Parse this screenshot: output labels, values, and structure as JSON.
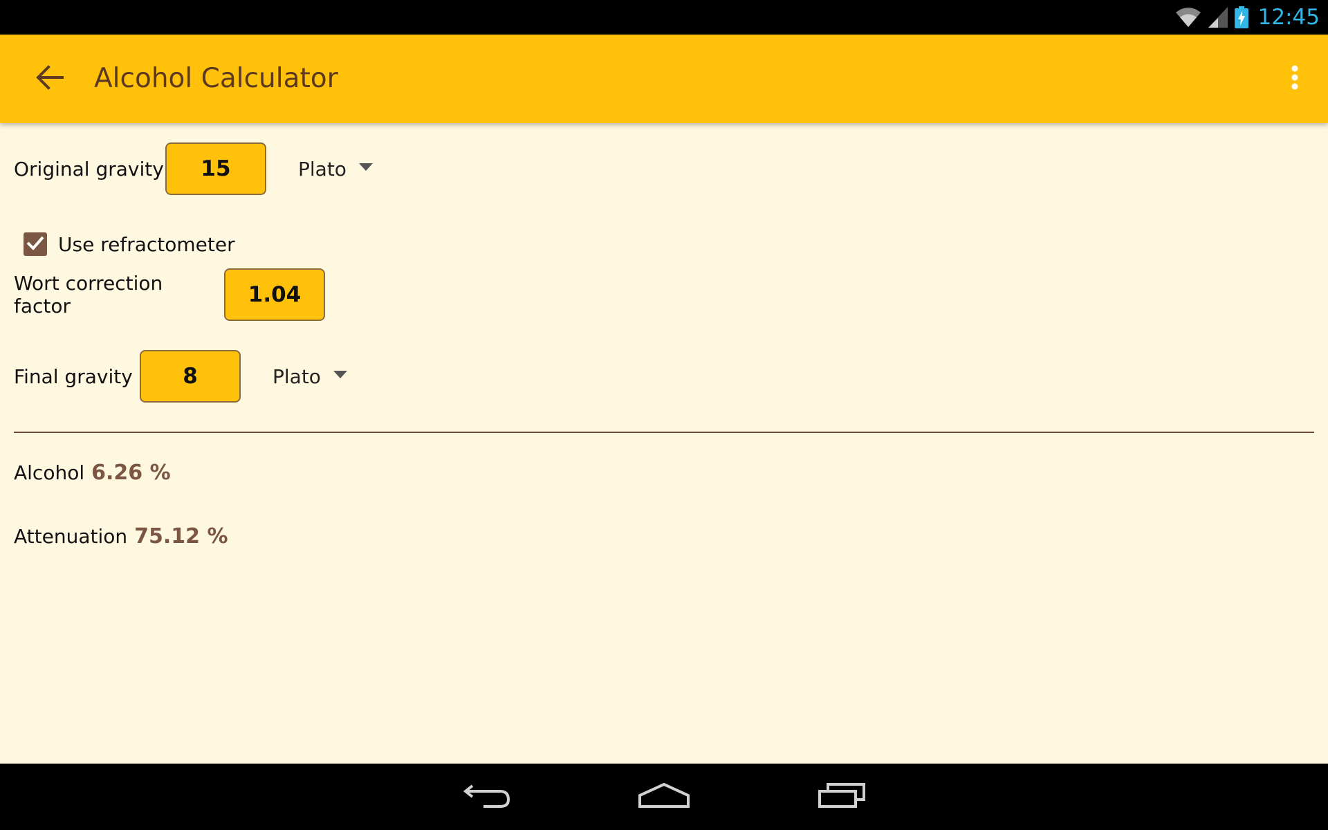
{
  "status_bar": {
    "time": "12:45",
    "icons": [
      "wifi-icon",
      "cell-signal-icon",
      "battery-charging-icon"
    ]
  },
  "app_bar": {
    "title": "Alcohol Calculator",
    "back_icon": "arrow-back-icon",
    "menu_icon": "more-vert-icon",
    "color": "#FFC10A"
  },
  "form": {
    "original_gravity": {
      "label": "Original gravity",
      "value": "15",
      "unit": "Plato"
    },
    "use_refractometer": {
      "label": "Use refractometer",
      "checked": true
    },
    "wort_correction": {
      "label": "Wort correction factor",
      "value": "1.04"
    },
    "final_gravity": {
      "label": "Final gravity",
      "value": "8",
      "unit": "Plato"
    }
  },
  "results": {
    "alcohol": {
      "label": "Alcohol",
      "value": "6.26 %"
    },
    "attenuation": {
      "label": "Attenuation",
      "value": "75.12 %"
    }
  },
  "colors": {
    "background": "#FFF8E1",
    "accent": "#FFC10A",
    "result_text": "#7B5743"
  },
  "nav_bar": {
    "buttons": [
      "back-nav-icon",
      "home-nav-icon",
      "recents-nav-icon"
    ]
  }
}
